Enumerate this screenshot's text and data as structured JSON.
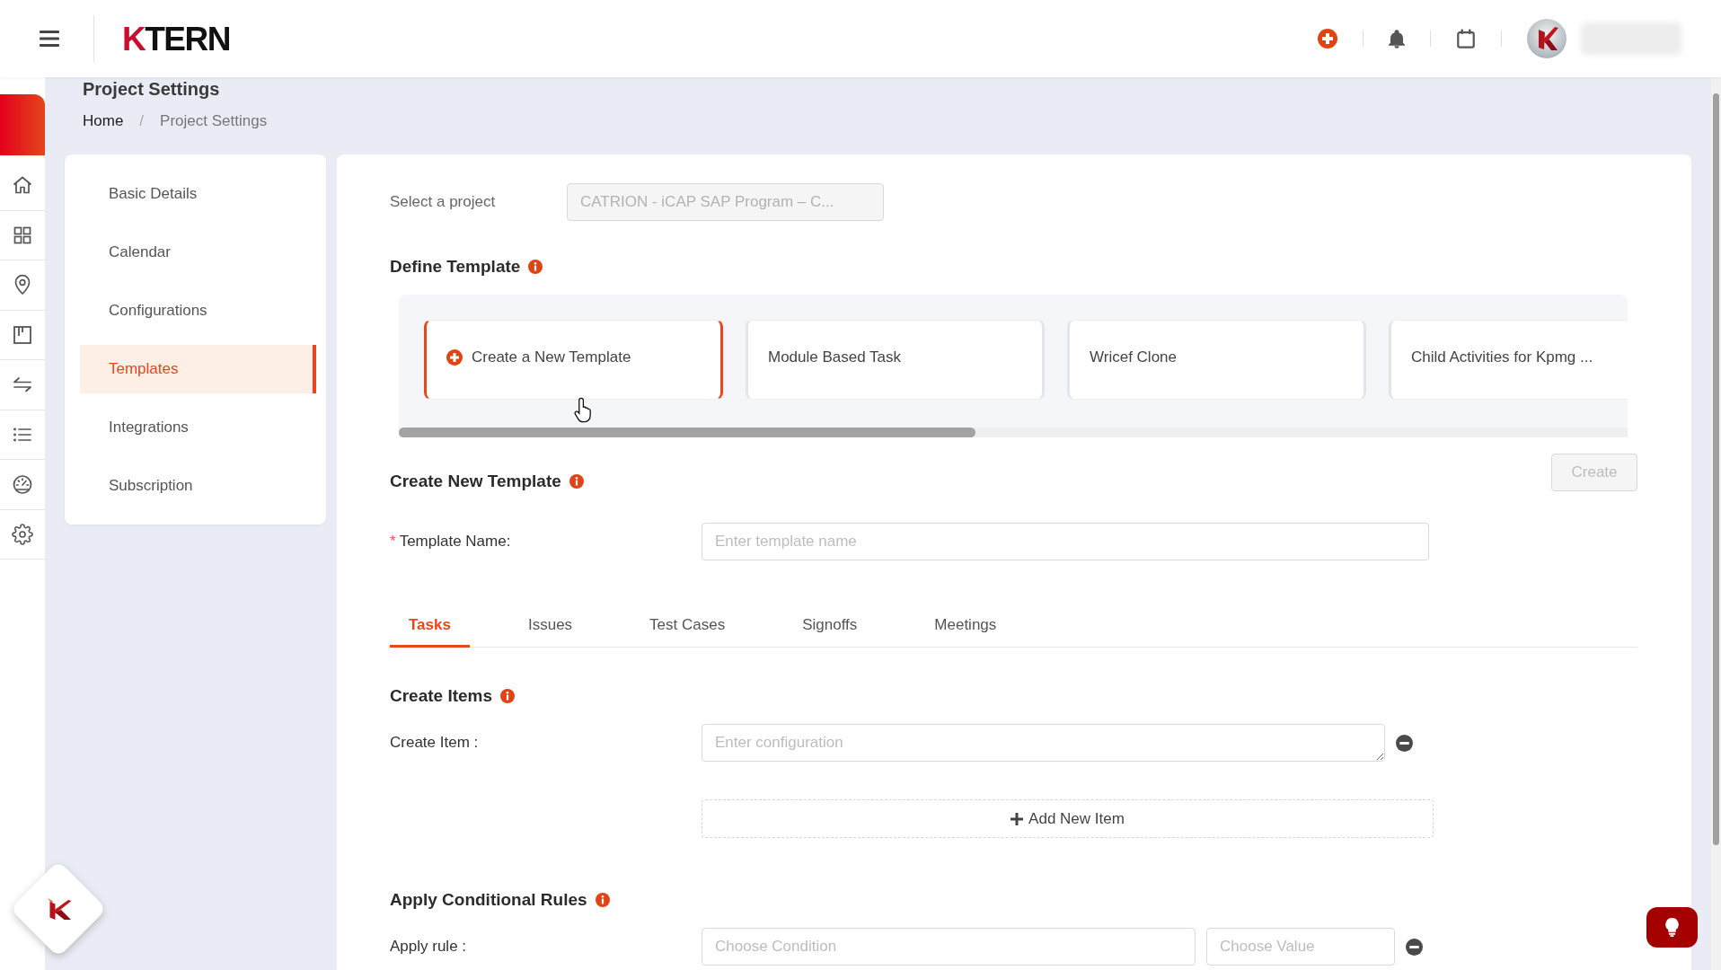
{
  "topbar": {
    "logo": "KTERN"
  },
  "page": {
    "title": "Project Settings",
    "breadcrumb": {
      "separator": "/",
      "items": [
        {
          "label": "Home",
          "current": false
        },
        {
          "label": "Project Settings",
          "current": true
        }
      ]
    }
  },
  "settings_menu": {
    "items": [
      {
        "label": "Basic Details",
        "selected": false
      },
      {
        "label": "Calendar",
        "selected": false
      },
      {
        "label": "Configurations",
        "selected": false
      },
      {
        "label": "Templates",
        "selected": true
      },
      {
        "label": "Integrations",
        "selected": false
      },
      {
        "label": "Subscription",
        "selected": false
      }
    ]
  },
  "project_select": {
    "label": "Select a project",
    "value": "CATRION - iCAP SAP Program – C...",
    "disabled": true
  },
  "define_template": {
    "title": "Define Template",
    "cards": [
      {
        "kind": "new",
        "label": "Create a New Template",
        "selected": true
      },
      {
        "kind": "template",
        "label": "Module Based Task",
        "selected": false
      },
      {
        "kind": "template",
        "label": "Wricef Clone",
        "selected": false
      },
      {
        "kind": "template",
        "label": "Child Activities for Kpmg ...",
        "selected": false
      }
    ]
  },
  "create_new_template": {
    "title": "Create New Template",
    "create_button": {
      "label": "Create",
      "disabled": true
    },
    "template_name": {
      "required_mark": "*",
      "label": "Template Name:",
      "placeholder": "Enter template name"
    }
  },
  "tabs": [
    {
      "label": "Tasks",
      "selected": true
    },
    {
      "label": "Issues",
      "selected": false
    },
    {
      "label": "Test Cases",
      "selected": false
    },
    {
      "label": "Signoffs",
      "selected": false
    },
    {
      "label": "Meetings",
      "selected": false
    }
  ],
  "create_items": {
    "title": "Create Items",
    "items": [
      {
        "label": "Create Item :",
        "placeholder": "Enter configuration"
      }
    ],
    "add_button": "Add New Item"
  },
  "conditional_rules": {
    "title": "Apply Conditional Rules",
    "rules": [
      {
        "label": "Apply rule :",
        "condition": {
          "placeholder": "Choose Condition"
        },
        "value": {
          "placeholder": "Choose Value"
        }
      }
    ]
  }
}
